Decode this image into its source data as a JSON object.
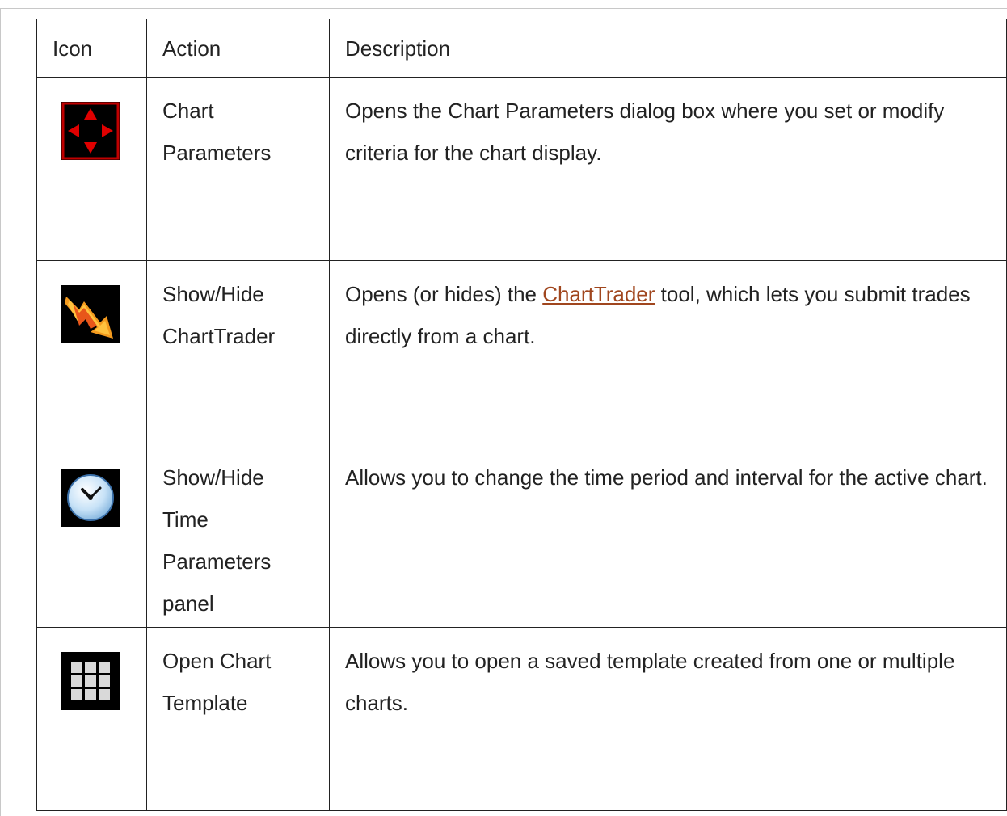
{
  "table": {
    "headers": {
      "icon": "Icon",
      "action": "Action",
      "description": "Description"
    },
    "rows": [
      {
        "icon": "chart-parameters-icon",
        "action": "Chart Parameters",
        "description": "Opens the Chart Parameters dialog box where you set or modify criteria for the chart display."
      },
      {
        "icon": "chart-trader-icon",
        "action": "Show/Hide ChartTrader",
        "description_before": "Opens (or hides) the ",
        "description_link": "ChartTrader",
        "description_after": " tool, which lets you submit trades directly from a chart."
      },
      {
        "icon": "clock-icon",
        "action": "Show/Hide Time Parameters panel",
        "description": "Allows you to change the time period and interval for the active chart."
      },
      {
        "icon": "grid-template-icon",
        "action": "Open Chart Template",
        "description": "Allows you to open a saved template created from one or multiple charts."
      }
    ]
  },
  "colors": {
    "link": "#a0461e",
    "border": "#222222",
    "icon_background": "#000000",
    "icon_red": "#e00000",
    "icon_orange": "#f5a623"
  }
}
